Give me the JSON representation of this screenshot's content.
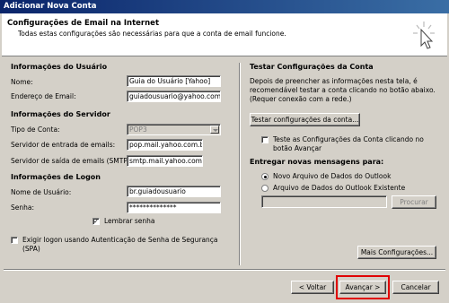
{
  "window": {
    "title": "Adicionar Nova Conta"
  },
  "header": {
    "title": "Configurações de Email na Internet",
    "subtitle": "Todas estas configurações são necessárias para que a conta de email funcione.",
    "icon": "cursor-pointer-icon"
  },
  "user_info": {
    "heading": "Informações do Usuário",
    "name_label": "Nome:",
    "name_value": "Guia do Usuário [Yahoo]",
    "email_label": "Endereço de Email:",
    "email_value": "guiadousuario@yahoo.com.br"
  },
  "server_info": {
    "heading": "Informações do Servidor",
    "account_type_label": "Tipo de Conta:",
    "account_type_value": "POP3",
    "incoming_label": "Servidor de entrada de emails:",
    "incoming_value": "pop.mail.yahoo.com.br",
    "outgoing_label": "Servidor de saída de emails (SMTP):",
    "outgoing_value": "smtp.mail.yahoo.com.br"
  },
  "logon_info": {
    "heading": "Informações de Logon",
    "username_label": "Nome de Usuário:",
    "username_value": "br.guiadousuario",
    "password_label": "Senha:",
    "password_value": "**************",
    "remember_label": "Lembrar senha",
    "remember_checked": "✓",
    "spa_label_line1": "Exigir logon usando Autenticação de Senha de Segurança",
    "spa_label_line2": "(SPA)"
  },
  "test_settings": {
    "heading": "Testar Configurações da Conta",
    "desc_line1": "Depois de preencher as informações nesta tela, é",
    "desc_line2": "recomendável testar a conta clicando no botão abaixo.",
    "desc_line3": "(Requer conexão com a rede.)",
    "test_button": "Testar configurações da conta...",
    "auto_test_line1": "Teste as Configurações da Conta clicando no",
    "auto_test_line2": "botão Avançar"
  },
  "delivery": {
    "heading": "Entregar novas mensagens para:",
    "option_new": "Novo Arquivo de Dados do Outlook",
    "option_existing": "Arquivo de Dados do Outlook Existente",
    "browse_button": "Procurar"
  },
  "more_settings_button": "Mais Configurações...",
  "footer": {
    "back": "< Voltar",
    "next": "Avançar >",
    "cancel": "Cancelar"
  },
  "colors": {
    "title_bar": "#0a246a",
    "highlight": "#e00000",
    "face": "#d4d0c8"
  }
}
